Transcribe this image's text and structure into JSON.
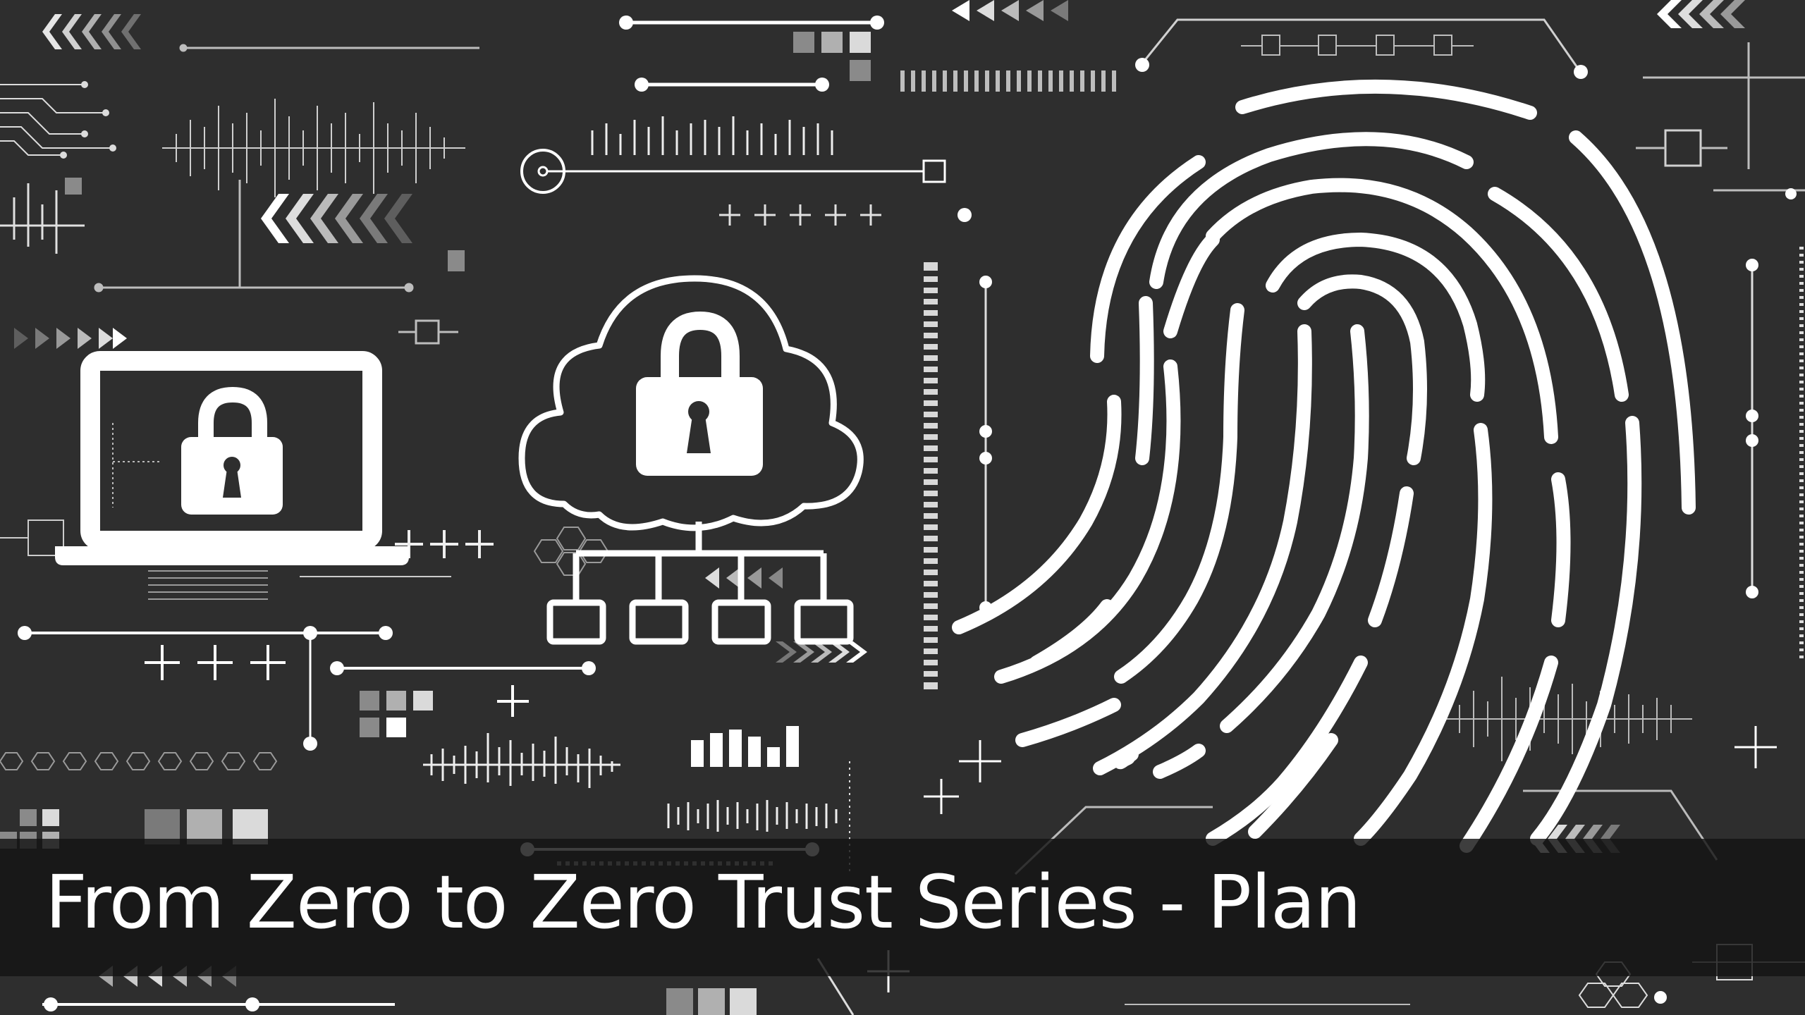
{
  "banner": {
    "title": "From Zero to Zero Trust Series - Plan"
  },
  "icons": [
    "laptop-lock-icon",
    "cloud-lock-network-icon",
    "fingerprint-icon"
  ],
  "colors": {
    "background": "#2e2e2e",
    "foreground": "#ffffff",
    "accent_gray": "#9a9a9a",
    "title_bar": "#141414"
  }
}
